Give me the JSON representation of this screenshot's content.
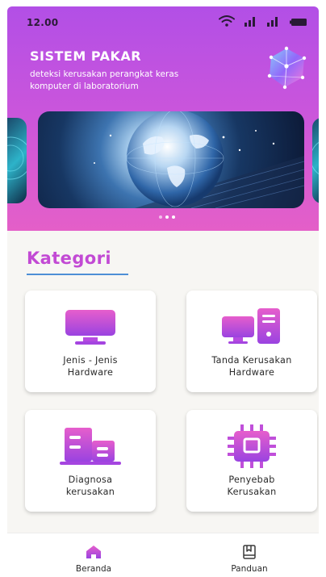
{
  "status_bar": {
    "time": "12.00",
    "icons": [
      "wifi-icon",
      "signal-icon",
      "signal-icon",
      "battery-icon"
    ]
  },
  "header": {
    "title": "SISTEM PAKAR",
    "subtitle": "deteksi kerusakan perangkat keras komputer di laboratorium",
    "logo_icon": "network-crystal-icon"
  },
  "carousel": {
    "slide_count": 3,
    "active_index": 2
  },
  "category": {
    "title": "Kategori",
    "cards": [
      {
        "line1": "Jenis - Jenis",
        "line2": "Hardware",
        "icon": "monitor-icon"
      },
      {
        "line1": "Tanda Kerusakan",
        "line2": "Hardware",
        "icon": "desktop-computer-icon"
      },
      {
        "line1": "Diagnosa",
        "line2": "kerusakan",
        "icon": "buildings-icon"
      },
      {
        "line1": "Penyebab",
        "line2": "Kerusakan",
        "icon": "cpu-chip-icon"
      }
    ]
  },
  "bottom_nav": {
    "items": [
      {
        "label": "Beranda",
        "icon": "home-icon",
        "active": true
      },
      {
        "label": "Panduan",
        "icon": "book-icon",
        "active": false
      }
    ]
  },
  "colors": {
    "accent": "#c24ad4",
    "header_top": "#b24fe6",
    "header_bottom": "#e45fc8",
    "icon_gradient_top": "#e65ecc",
    "icon_gradient_bottom": "#9a43e0",
    "underline": "#4e8fd6"
  }
}
